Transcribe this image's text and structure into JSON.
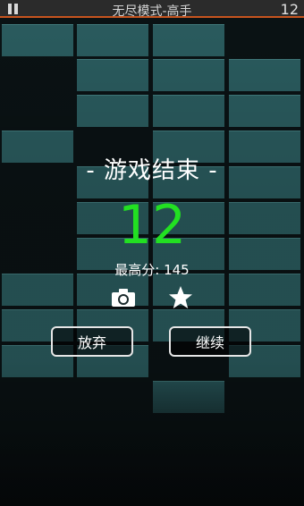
{
  "header": {
    "mode_title": "无尽模式-高手",
    "score": "12"
  },
  "dialog": {
    "title": "- 游戏结束 -",
    "score": "12",
    "best_label": "最高分:",
    "best_value": "145",
    "quit_label": "放弃",
    "continue_label": "继续"
  },
  "icons": [
    "pause-icon",
    "camera-icon",
    "star-icon"
  ],
  "colors": {
    "tile": "#2a5b5e",
    "background": "#0a1214",
    "score_green": "#22e022",
    "accent_line": "#c7541f"
  }
}
